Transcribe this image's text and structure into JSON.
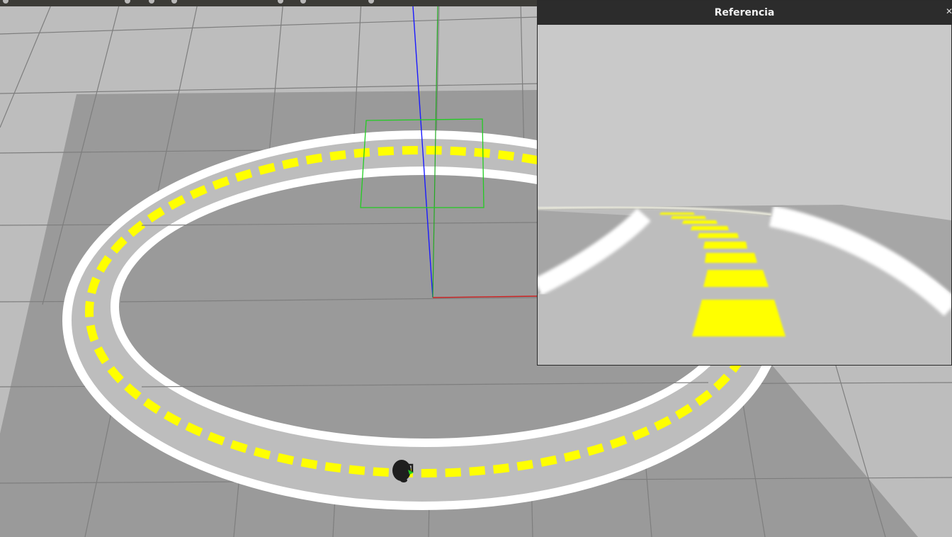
{
  "window": {
    "title": "Referencia",
    "close_icon": "close-icon"
  },
  "scene": {
    "camera_frustum_color": "#22cc22",
    "axis_colors": {
      "x": "#cc2222",
      "y": "#22aa22",
      "z": "#1a1aff"
    },
    "lane_dash_color": "#ffff00",
    "lane_border_color": "#ffffff",
    "ground_color": "#9a9a9a",
    "plane_color": "#bdbdbd"
  },
  "toolbar": {
    "icons": [
      "translate-icon",
      "rotate-icon",
      "scale-icon",
      "undo-icon",
      "redo-icon",
      "snap-icon"
    ]
  }
}
